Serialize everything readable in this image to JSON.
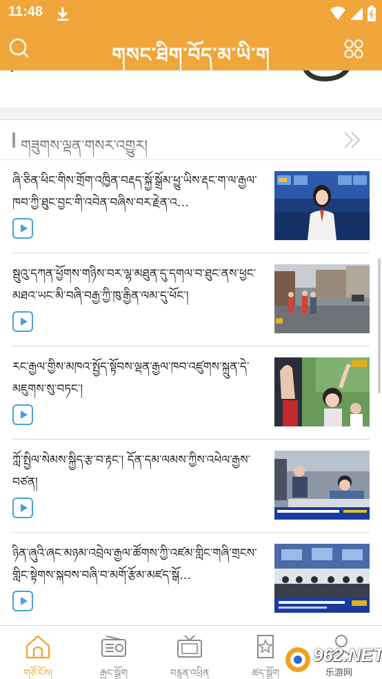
{
  "status_bar": {
    "time": "11:48"
  },
  "app": {
    "title": "གསང་ཐིག་བོད་མ་ཡི་ག"
  },
  "section": {
    "title": "གཟུགས་ལྡན་གསར་འགྱུར།"
  },
  "colors": {
    "accent": "#f0a63a",
    "play": "#4a9fd8"
  },
  "news": [
    {
      "title": "ཞི་ཅིན་ཕིང་གིས་གྲོག་འཁྱིན་བརྡད་སྐྱོ་སྒྲོམ་ཕྱུ་ཡིས་རྡང་ག་ལ་རྒྱལ་ཁབ་ཀྱི་ཐུང་བྱང་གི་འབེན་བཞིས་བར་རྗེན་འ…",
      "image": "news-broadcast"
    },
    {
      "title": "སྦུའུ་དཀན་ཕྱོགས་གཉིས་བར་ལྷ་མཐུན་དུ་དགལ་བ་ཐུང་ནས་ཕྱང་མཐའ་ཡང་མི་བཞི་བརྒྱ་ཀྱི་ཁུ་རྒྱིན་ལམ་དུ་ཕོང་།",
      "image": "street-scene"
    },
    {
      "title": "རང་རྒྱལ་གྱིས་མཁའ་སྤྱོད་སྟོབས་ལྡན་རྒྱལ་ཁབ་འཛུགས་སྐྲུན་དེ་མཇུགས་སུ་བཏང་།",
      "image": "students-raising-hands"
    },
    {
      "title": "ཀློ་སྤྱིལ་སེམས་སྐྱིད་རྩ་བ་རྟང་། དོན་དམ་ལམས་ཀྱིས་འཕེལ་རྒྱས་བཙན།",
      "image": "meeting-room"
    },
    {
      "title": "ཉིན་ཞུའི་ཞང་མཉམ་འབྲེལ་རྒྱལ་ཚོགས་ཀྱི་འཛམ་གླིང་གཞི་གྲངས་གླིང་སྟེགས་སྐབས་བཞི་བ་མགོ་རྩོམ་མཛད་སྒོ…",
      "image": "conference-hall"
    }
  ],
  "tabs": [
    {
      "label": "གཙོ་ངོས།",
      "icon": "home-icon",
      "active": true
    },
    {
      "label": "རྒྱང་སྒྲོག",
      "icon": "radio-icon",
      "active": false
    },
    {
      "label": "བརྙན་འཕྲིན",
      "icon": "tv-icon",
      "active": false
    },
    {
      "label": "ཚད་སྒྲོག",
      "icon": "bookmark-icon",
      "active": false
    },
    {
      "label": "",
      "icon": "user-icon",
      "active": false
    }
  ],
  "watermark": {
    "brand": "962.NET",
    "sub": "乐游网"
  }
}
